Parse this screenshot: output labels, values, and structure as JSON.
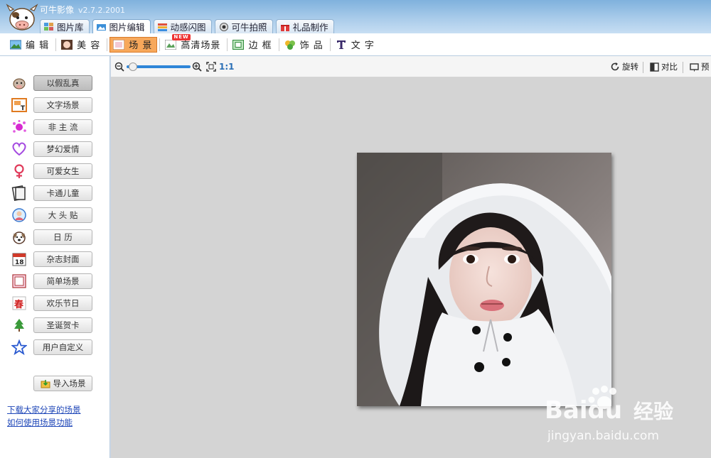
{
  "app": {
    "title": "可牛影像",
    "version": "v2.7.2.2001"
  },
  "main_tabs": [
    {
      "label": "图片库",
      "icon": "gallery-icon"
    },
    {
      "label": "图片编辑",
      "icon": "edit-photo-icon"
    },
    {
      "label": "动感闪图",
      "icon": "gif-icon"
    },
    {
      "label": "可牛拍照",
      "icon": "camera-icon"
    },
    {
      "label": "礼品制作",
      "icon": "gift-icon"
    }
  ],
  "sub_tabs": [
    {
      "label": "编 辑",
      "icon": "landscape-icon"
    },
    {
      "label": "美 容",
      "icon": "face-icon"
    },
    {
      "label": "场 景",
      "icon": "scene-icon"
    },
    {
      "label": "高清场景",
      "icon": "hd-scene-icon",
      "badge": "NEW"
    },
    {
      "label": "边 框",
      "icon": "frame-icon"
    },
    {
      "label": "饰 品",
      "icon": "clover-icon"
    },
    {
      "label": "文 字",
      "icon": "text-icon"
    }
  ],
  "scene_categories": [
    {
      "label": "以假乱真",
      "icon": "cow-icon"
    },
    {
      "label": "文字场景",
      "icon": "text-scene-icon"
    },
    {
      "label": "非 主 流",
      "icon": "splash-icon"
    },
    {
      "label": "梦幻爱情",
      "icon": "heart-icon"
    },
    {
      "label": "可爱女生",
      "icon": "female-icon"
    },
    {
      "label": "卡通儿童",
      "icon": "book-icon"
    },
    {
      "label": "大 头 贴",
      "icon": "sticker-photo-icon"
    },
    {
      "label": "日   历",
      "icon": "dog-face-icon"
    },
    {
      "label": "杂志封面",
      "icon": "calendar-icon"
    },
    {
      "label": "简单场景",
      "icon": "simple-frame-icon"
    },
    {
      "label": "欢乐节日",
      "icon": "spring-festival-icon"
    },
    {
      "label": "圣诞贺卡",
      "icon": "christmas-tree-icon"
    },
    {
      "label": "用户自定义",
      "icon": "star-icon"
    }
  ],
  "import_button": {
    "label": "导入场景",
    "icon": "folder-import-icon"
  },
  "links": {
    "download_shared": "下载大家分享的场景",
    "how_to_use": "如何使用场景功能"
  },
  "canvas_toolbar": {
    "zoom_level_fraction": 0.05,
    "actual_size_label": "1:1",
    "rotate_label": "旋转",
    "compare_label": "对比",
    "preview_label": "预"
  },
  "watermark": {
    "brand": "Baidu",
    "cn": "经验",
    "url": "jingyan.baidu.com"
  },
  "colors": {
    "accent_orange": "#f7a85b",
    "slider_blue": "#2f86d8",
    "link_blue": "#1f47b8",
    "titlebar_blue": "#7fb1dd"
  }
}
